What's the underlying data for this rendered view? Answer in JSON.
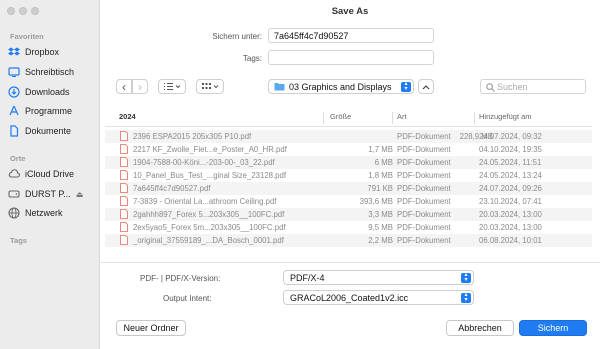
{
  "window": {
    "title": "Save As"
  },
  "sidebar": {
    "favorites_label": "Favoriten",
    "favorites": [
      {
        "label": "Dropbox",
        "icon": "dropbox-icon"
      },
      {
        "label": "Schreibtisch",
        "icon": "desktop-icon"
      },
      {
        "label": "Downloads",
        "icon": "downloads-icon"
      },
      {
        "label": "Programme",
        "icon": "applications-icon"
      },
      {
        "label": "Dokumente",
        "icon": "documents-icon"
      }
    ],
    "locations_label": "Orte",
    "locations": [
      {
        "label": "iCloud Drive",
        "icon": "cloud-icon"
      },
      {
        "label": "DURST P...",
        "icon": "drive-icon",
        "eject": "⏏"
      },
      {
        "label": "Netzwerk",
        "icon": "network-icon"
      }
    ],
    "tags_label": "Tags"
  },
  "save_form": {
    "save_as_label": "Sichern unter:",
    "save_as_value": "7a645ff4c7d90527",
    "tags_label": "Tags:",
    "tags_value": ""
  },
  "toolbar": {
    "back": "‹",
    "forward": "›",
    "location": "03 Graphics and Displays",
    "search_placeholder": "Suchen"
  },
  "file_table": {
    "columns": [
      "2024",
      "Größe",
      "Art",
      "Hinzugefügt am"
    ],
    "rows": [
      [
        "2396 ESPA2015 205x305 P10.pdf",
        "228,9 MB",
        "PDF-Dokument",
        "24.07.2024, 09:32"
      ],
      [
        "2217 KF_Zwolle_Fiet...e_Poster_A0_HR.pdf",
        "1,7 MB",
        "PDF-Dokument",
        "04.10.2024, 19:35"
      ],
      [
        "1904-7588-00-Köni...-203-00-_03_22.pdf",
        "6 MB",
        "PDF-Dokument",
        "24.05.2024, 11:51"
      ],
      [
        "10_Panel_Bus_Test_...ginal Size_23128.pdf",
        "1,8 MB",
        "PDF-Dokument",
        "24.05.2024, 13:24"
      ],
      [
        "7a645ff4c7d90527.pdf",
        "791 KB",
        "PDF-Dokument",
        "24.07.2024, 09:26"
      ],
      [
        "7-3839 - Oriental La...athroom Ceiling.pdf",
        "393,6 MB",
        "PDF-Dokument",
        "23.10.2024, 07:41"
      ],
      [
        "2gahhh897_Forex 5...203x305__100FC.pdf",
        "3,3 MB",
        "PDF-Dokument",
        "20.03.2024, 13:00"
      ],
      [
        "2ex5yao5_Forex 5m...203x305__100FC.pdf",
        "9,5 MB",
        "PDF-Dokument",
        "20.03.2024, 13:00"
      ],
      [
        "_original_37559189_...DA_Bosch_0001.pdf",
        "2,2 MB",
        "PDF-Dokument",
        "06.08.2024, 10:01"
      ]
    ]
  },
  "options": {
    "pdfx_label": "PDF- | PDF/X-Version:",
    "pdfx_value": "PDF/X-4",
    "intent_label": "Output Intent:",
    "intent_value": "GRACoL2006_Coated1v2.icc"
  },
  "buttons": {
    "new_folder": "Neuer Ordner",
    "cancel": "Abbrechen",
    "save": "Sichern"
  },
  "colors": {
    "accent": "#1f7cf2",
    "sidebar_bg": "#ececec",
    "pdf_icon": "#e8675a"
  }
}
